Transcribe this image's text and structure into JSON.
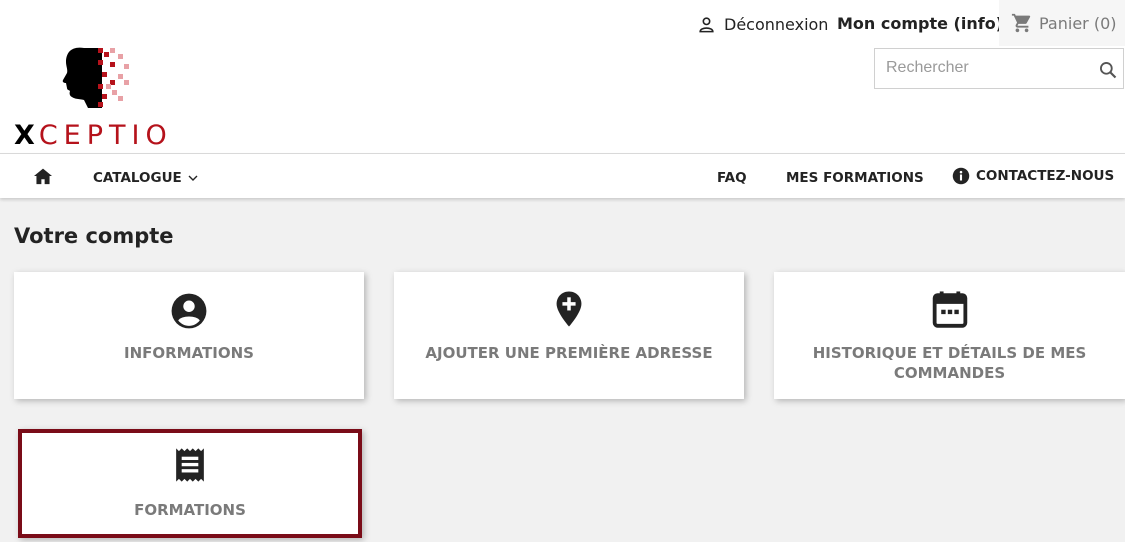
{
  "brand": {
    "logo_text_x": "X",
    "logo_text_rest": "CEPTIO",
    "accent": "#b5121b"
  },
  "header": {
    "logout_label": "Déconnexion",
    "account_label": "Mon compte (info)",
    "cart_label": "Panier (0)",
    "search_placeholder": "Rechercher"
  },
  "nav": {
    "catalogue": "CATALOGUE",
    "faq": "FAQ",
    "mes_formations": "MES FORMATIONS",
    "contact": "CONTACTEZ-NOUS"
  },
  "page": {
    "title": "Votre compte"
  },
  "tiles": [
    {
      "label": "INFORMATIONS",
      "icon": "account-circle-icon"
    },
    {
      "label": "AJOUTER UNE PREMIÈRE ADRESSE",
      "icon": "add-location-icon"
    },
    {
      "label": "HISTORIQUE ET DÉTAILS DE MES COMMANDES",
      "icon": "calendar-icon"
    },
    {
      "label": "FORMATIONS",
      "icon": "receipt-icon"
    }
  ]
}
